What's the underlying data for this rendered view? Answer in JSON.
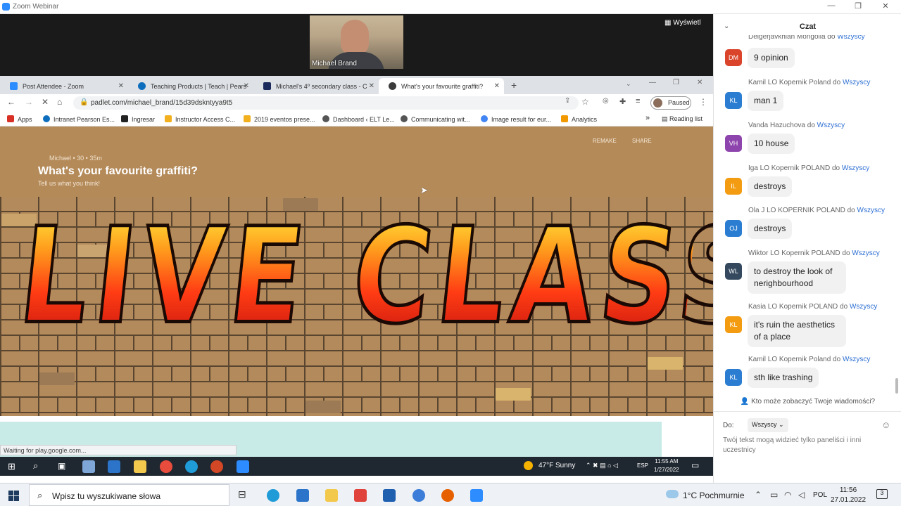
{
  "zoom": {
    "window_title": "Zoom Webinar",
    "presenter_name": "Michael Brand",
    "view_button": "Wyświetl"
  },
  "browser": {
    "tabs": [
      {
        "label": "Post Attendee - Zoom",
        "color": "#2d8cff"
      },
      {
        "label": "Teaching Products | Teach | Pears",
        "color": "#0d6ebd"
      },
      {
        "label": "Michael's 4º secondary class - C",
        "color": "#1b2a5c"
      },
      {
        "label": "What's your favourite graffiti?",
        "color": "#3b3b3b"
      }
    ],
    "new_tab": "+",
    "url": "padlet.com/michael_brand/15d39dskntyya9t5",
    "profile_status": "Paused",
    "bookmarks": [
      {
        "label": "Apps",
        "color": "#d93025"
      },
      {
        "label": "Intranet Pearson Es...",
        "color": "#0d6ebd"
      },
      {
        "label": "Ingresar",
        "color": "#222222"
      },
      {
        "label": "Instructor Access C...",
        "color": "#f2b01e"
      },
      {
        "label": "2019 eventos prese...",
        "color": "#f2b01e"
      },
      {
        "label": "Dashboard ‹ ELT Le...",
        "color": "#555555"
      },
      {
        "label": "Communicating wit...",
        "color": "#555555"
      },
      {
        "label": "Image result for eur...",
        "color": "#4285f4"
      },
      {
        "label": "Analytics",
        "color": "#f29900"
      }
    ],
    "bookmarks_more": "»",
    "reading_list": "Reading list",
    "status_tip": "Waiting for play.google.com..."
  },
  "padlet": {
    "meta": "Michael • 30 • 35m",
    "title": "What's your favourite graffiti?",
    "subtitle": "Tell us what you think!",
    "remake": "REMAKE",
    "share": "SHARE",
    "graffiti_text": "LIVE CLASSES"
  },
  "remote_taskbar": {
    "weather": "47°F  Sunny",
    "lang": "ESP",
    "time": "11:55 AM",
    "date": "1/27/2022"
  },
  "chat": {
    "title": "Czat",
    "messages": [
      {
        "initials": "DM",
        "color": "#d9442a",
        "from": "Delgerjavkhlan Mongolia",
        "to": "Wszyscy",
        "text": "9 opinion"
      },
      {
        "initials": "KL",
        "color": "#2a7dd1",
        "from": "Kamil LO Kopernik Poland",
        "to": "Wszyscy",
        "text": "man 1"
      },
      {
        "initials": "VH",
        "color": "#8e44ad",
        "from": "Vanda Hazuchova",
        "to": "Wszyscy",
        "text": "10 house"
      },
      {
        "initials": "IL",
        "color": "#f39c12",
        "from": "Iga LO Kopernik POLAND",
        "to": "Wszyscy",
        "text": "destroys"
      },
      {
        "initials": "OJ",
        "color": "#2a7dd1",
        "from": "Ola J LO KOPERNIK POLAND",
        "to": "Wszyscy",
        "text": "destroys"
      },
      {
        "initials": "WL",
        "color": "#34495e",
        "from": "Wiktor LO Kopernik POLAND",
        "to": "Wszyscy",
        "text": "to destroy the look of nerighbourhood"
      },
      {
        "initials": "KL",
        "color": "#f39c12",
        "from": "Kasia LO Kopernik POLAND",
        "to": "Wszyscy",
        "text": "it's ruin the aesthetics of a place"
      },
      {
        "initials": "KL",
        "color": "#2a7dd1",
        "from": "Kamil LO Kopernik Poland",
        "to": "Wszyscy",
        "text": "sth like trashing"
      }
    ],
    "connector": "do",
    "who_can_see": "Kto może zobaczyć Twoje wiadomości?",
    "to_label": "Do:",
    "to_value": "Wszyscy",
    "hint": "Twój tekst mogą widzieć tylko paneliści i inni uczestnicy"
  },
  "taskbar": {
    "search_placeholder": "Wpisz tu wyszukiwane słowa",
    "weather": "1°C  Pochmurnie",
    "lang": "POL",
    "time": "11:56",
    "date": "27.01.2022",
    "notifications": "3"
  }
}
